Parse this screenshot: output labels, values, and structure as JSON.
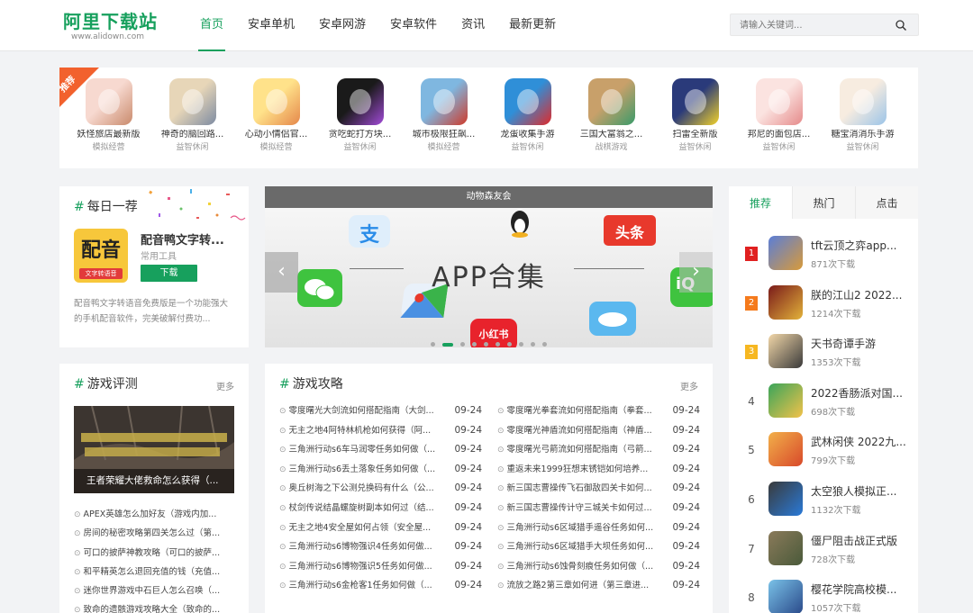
{
  "header": {
    "logo_main": "阿里下载站",
    "logo_sub": "www.alidown.com",
    "nav": [
      "首页",
      "安卓单机",
      "安卓网游",
      "安卓软件",
      "资讯",
      "最新更新"
    ],
    "search_placeholder": "请输入关键词...",
    "accent": "#17a05d"
  },
  "recommend": {
    "badge": "推荐",
    "items": [
      {
        "name": "妖怪旅店最新版",
        "cat": "模拟经营",
        "icon": "anime-girl-icon",
        "c1": "#f7d9d0",
        "c2": "#c98a6c"
      },
      {
        "name": "神奇的脑回路...",
        "cat": "益智休闲",
        "icon": "cartoon-room-icon",
        "c1": "#e7d6b8",
        "c2": "#7d8ba2"
      },
      {
        "name": "心动小情侣官...",
        "cat": "模拟经营",
        "icon": "couple-icon",
        "c1": "#ffe28a",
        "c2": "#e5874a"
      },
      {
        "name": "贪吃蛇打方块...",
        "cat": "益智休闲",
        "icon": "snake-block-icon",
        "c1": "#1a1a1a",
        "c2": "#a24bd8"
      },
      {
        "name": "城市极限狂飙...",
        "cat": "模拟经营",
        "icon": "tractor-icon",
        "c1": "#7fb7e0",
        "c2": "#cf3a2a"
      },
      {
        "name": "龙蛋收集手游",
        "cat": "益智休闲",
        "icon": "dinosaur-icon",
        "c1": "#2f8fd8",
        "c2": "#e02a2a"
      },
      {
        "name": "三国大富翁之...",
        "cat": "战棋游戏",
        "icon": "board-game-icon",
        "c1": "#c8a06a",
        "c2": "#3a9b6a"
      },
      {
        "name": "扫雷全新版",
        "cat": "益智休闲",
        "icon": "minesweeper-icon",
        "c1": "#2a3a7a",
        "c2": "#f2d22a"
      },
      {
        "name": "邦尼的面包店...",
        "cat": "益智休闲",
        "icon": "bunny-girl-icon",
        "c1": "#fbe3e0",
        "c2": "#e58a8a"
      },
      {
        "name": "糖宝消消乐手游",
        "cat": "益智休闲",
        "icon": "blonde-girl-icon",
        "c1": "#f7ece0",
        "c2": "#9bc4e8"
      }
    ]
  },
  "daily": {
    "title": "每日一荐",
    "icon_text": "配音",
    "icon_strip": "文字转语音",
    "name": "配音鸭文字转...",
    "cat": "常用工具",
    "download": "下载",
    "desc": "配音鸭文字转语音免费版是一个功能强大的手机配音软件，完美破解付费功..."
  },
  "banner": {
    "top_label": "动物森友会",
    "title": "APP合集",
    "prev": "‹",
    "next": "›",
    "dot_count": 10,
    "active_dot": 1,
    "apps": [
      {
        "text": "支",
        "color": "#2a8ce8",
        "icon": "alipay-icon"
      },
      {
        "text": "头条",
        "color": "#e8392c",
        "icon": "toutiao-icon"
      },
      {
        "text": "小红书",
        "color": "#e8232c",
        "icon": "xiaohongshu-icon"
      }
    ]
  },
  "rank": {
    "tabs": [
      "推荐",
      "热门",
      "点击"
    ],
    "items": [
      {
        "num": "1",
        "name": "tft云顶之弈app...",
        "count": "871次下载",
        "icon": "tft-icon",
        "c1": "#5a7ed8",
        "c2": "#d89a3a"
      },
      {
        "num": "2",
        "name": "朕的江山2 2022...",
        "count": "1214次下载",
        "icon": "emperor-icon",
        "c1": "#7a1a1a",
        "c2": "#e2b23a"
      },
      {
        "num": "3",
        "name": "天书奇谭手游",
        "count": "1353次下载",
        "icon": "tianshu-icon",
        "c1": "#f2d7a8",
        "c2": "#3a3a3a"
      },
      {
        "num": "4",
        "name": "2022香肠派对国...",
        "count": "698次下载",
        "icon": "sausage-icon",
        "c1": "#3aa55a",
        "c2": "#f2c24a"
      },
      {
        "num": "5",
        "name": "武林闲侠 2022九...",
        "count": "799次下载",
        "icon": "wulin-icon",
        "c1": "#f2b04a",
        "c2": "#d8492a"
      },
      {
        "num": "6",
        "name": "太空狼人模拟正...",
        "count": "1132次下载",
        "icon": "space-wolf-icon",
        "c1": "#3a3a3a",
        "c2": "#2a7ad8"
      },
      {
        "num": "7",
        "name": "僵尸阻击战正式版",
        "count": "728次下载",
        "icon": "zombie-icon",
        "c1": "#8a7a5a",
        "c2": "#4a5a3a"
      },
      {
        "num": "8",
        "name": "樱花学院高校模...",
        "count": "1057次下载",
        "icon": "sakura-icon",
        "c1": "#7ac2e8",
        "c2": "#2a4a8a"
      }
    ]
  },
  "review": {
    "title": "游戏评测",
    "more": "更多",
    "image_caption": "王者荣耀大佬救命怎么获得（...",
    "items": [
      "APEX英雄怎么加好友（游戏内加...",
      "房间的秘密攻略第四关怎么过（第...",
      "可口的披萨神教攻略（可口的披萨...",
      "和平精英怎么退回充值的钱（充值...",
      "迷你世界游戏中石巨人怎么召唤（...",
      "致命的遗骸游戏攻略大全（致命的..."
    ]
  },
  "strategy": {
    "title": "游戏攻略",
    "more": "更多",
    "left": [
      {
        "title": "零度曙光大剑流如何搭配指南（大剑...",
        "date": "09-24"
      },
      {
        "title": "无主之地4阿特林机枪如何获得（阿...",
        "date": "09-24"
      },
      {
        "title": "三角洲行动s6车马润零任务如何做（...",
        "date": "09-24"
      },
      {
        "title": "三角洲行动s6丢土落象任务如何做（...",
        "date": "09-24"
      },
      {
        "title": "奥丘树海之下公测兑换码有什么（公...",
        "date": "09-24"
      },
      {
        "title": "杖剑传说结晶螺旋树副本如何过（结...",
        "date": "09-24"
      },
      {
        "title": "无主之地4安全屋如何占领（安全屋...",
        "date": "09-24"
      },
      {
        "title": "三角洲行动s6博物强识4任务如何做...",
        "date": "09-24"
      },
      {
        "title": "三角洲行动s6博物强识5任务如何做...",
        "date": "09-24"
      },
      {
        "title": "三角洲行动s6金枪客1任务如何做（...",
        "date": "09-24"
      }
    ],
    "right": [
      {
        "title": "零度曙光拳套流如何搭配指南（拳套...",
        "date": "09-24"
      },
      {
        "title": "零度曙光神盾流如何搭配指南（神盾...",
        "date": "09-24"
      },
      {
        "title": "零度曙光弓箭流如何搭配指南（弓箭...",
        "date": "09-24"
      },
      {
        "title": "重返未来1999狂想末锈铠如何培养...",
        "date": "09-24"
      },
      {
        "title": "新三国志曹操传飞石御敌四关卡如何...",
        "date": "09-24"
      },
      {
        "title": "新三国志曹操传计守三城关卡如何过...",
        "date": "09-24"
      },
      {
        "title": "三角洲行动s6区域猎手遥谷任务如何...",
        "date": "09-24"
      },
      {
        "title": "三角洲行动s6区域猎手大坝任务如何...",
        "date": "09-24"
      },
      {
        "title": "三角洲行动s6蚀骨刻痕任务如何做（...",
        "date": "09-24"
      },
      {
        "title": "流放之路2第三章如何进（第三章进...",
        "date": "09-24"
      }
    ]
  }
}
